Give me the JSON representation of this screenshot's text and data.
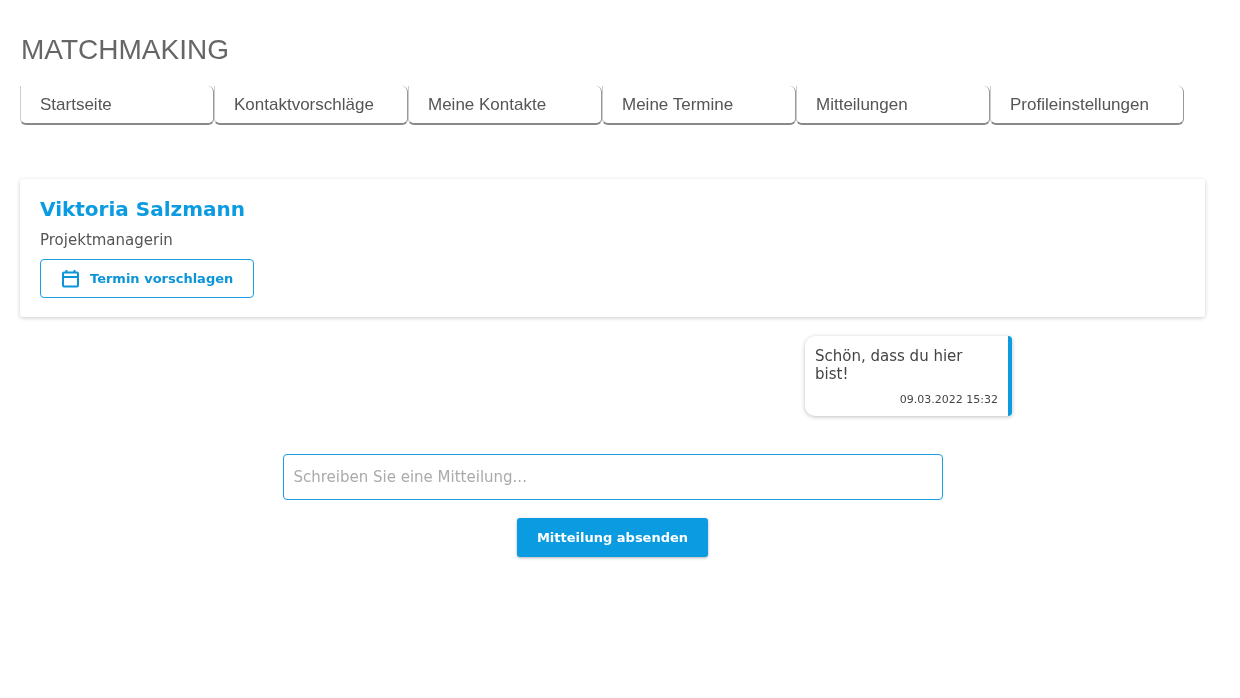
{
  "app_title": "MATCHMAKING",
  "tabs": [
    {
      "label": "Startseite"
    },
    {
      "label": "Kontaktvorschläge"
    },
    {
      "label": "Meine Kontakte"
    },
    {
      "label": "Meine Termine"
    },
    {
      "label": "Mitteilungen"
    },
    {
      "label": "Profileinstellungen"
    }
  ],
  "contact": {
    "name": "Viktoria Salzmann",
    "role": "Projektmanagerin",
    "action": "Termin vorschlagen"
  },
  "messages": [
    {
      "text": "Schön, dass du hier bist!",
      "time": "09.03.2022 15:32"
    }
  ],
  "composer": {
    "placeholder": "Schreiben Sie eine Mitteilung...",
    "send": "Mitteilung absenden"
  }
}
